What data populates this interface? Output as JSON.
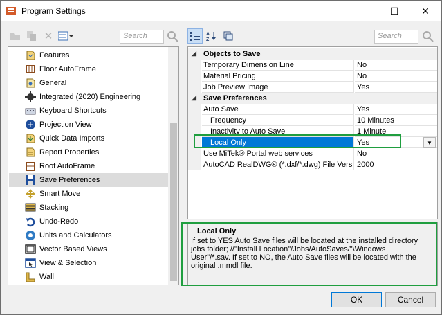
{
  "window": {
    "title": "Program Settings",
    "minimize_glyph": "—",
    "maximize_glyph": "☐",
    "close_glyph": "✕"
  },
  "left_toolbar": {
    "search_placeholder": "Search"
  },
  "sidebar": {
    "items": [
      {
        "label": "Features",
        "icon": "features-icon"
      },
      {
        "label": "Floor AutoFrame",
        "icon": "floor-autoframe-icon"
      },
      {
        "label": "General",
        "icon": "general-icon"
      },
      {
        "label": "Integrated (2020) Engineering",
        "icon": "gear-icon"
      },
      {
        "label": "Keyboard Shortcuts",
        "icon": "keyboard-icon"
      },
      {
        "label": "Projection View",
        "icon": "projection-icon"
      },
      {
        "label": "Quick Data Imports",
        "icon": "import-icon"
      },
      {
        "label": "Report Properties",
        "icon": "report-icon"
      },
      {
        "label": "Roof AutoFrame",
        "icon": "roof-autoframe-icon"
      },
      {
        "label": "Save Preferences",
        "icon": "save-icon",
        "selected": true
      },
      {
        "label": "Smart Move",
        "icon": "smart-move-icon"
      },
      {
        "label": "Stacking",
        "icon": "stacking-icon"
      },
      {
        "label": "Undo-Redo",
        "icon": "undo-icon"
      },
      {
        "label": "Units and Calculators",
        "icon": "calculator-icon"
      },
      {
        "label": "Vector Based Views",
        "icon": "vector-icon"
      },
      {
        "label": "View & Selection",
        "icon": "view-selection-icon"
      },
      {
        "label": "Wall",
        "icon": "wall-icon"
      }
    ]
  },
  "right_toolbar": {
    "search_placeholder": "Search"
  },
  "property_grid": {
    "categories": [
      {
        "name": "Objects to Save",
        "rows": [
          {
            "name": "Temporary Dimension Line",
            "value": "No"
          },
          {
            "name": "Material Pricing",
            "value": "No"
          },
          {
            "name": "Job Preview Image",
            "value": "Yes"
          }
        ]
      },
      {
        "name": "Save Preferences",
        "rows": [
          {
            "name": "Auto Save",
            "value": "Yes"
          },
          {
            "name": "Frequency",
            "value": "10 Minutes"
          },
          {
            "name": "Inactivity to Auto Save",
            "value": "1 Minute"
          },
          {
            "name": "Local Only",
            "value": "Yes"
          },
          {
            "name": "Use MiTek® Portal web services",
            "value": "No"
          },
          {
            "name": "AutoCAD RealDWG® (*.dxf/*.dwg) File Vers",
            "value": "2000"
          }
        ]
      }
    ]
  },
  "description": {
    "title": "Local Only",
    "line1": "If set to YES Auto Save files will be located at the installed directory",
    "line2": "jobs folder; //\"Install Location\"/Jobs/AutoSaves/\"\\Windows",
    "line3": "User\"/*.sav. If set to NO, the Auto Save files will be located with the",
    "line4": "original .mmdl file."
  },
  "buttons": {
    "ok": "OK",
    "cancel": "Cancel"
  },
  "colors": {
    "selection": "#0078d7",
    "highlight_box": "#1f9e3f"
  }
}
